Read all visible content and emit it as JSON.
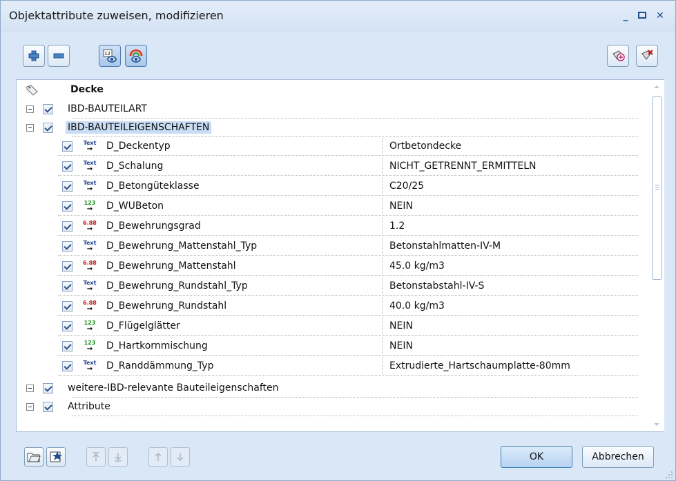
{
  "window": {
    "title": "Objektattribute zuweisen, modifizieren"
  },
  "colors": {
    "accent": "#2d4f86",
    "selection": "#c9ddf5",
    "text_icon": "#1f3f8f",
    "number_icon": "#1a8a1a",
    "decimal_icon": "#c01818"
  },
  "toolbar": {
    "left": [
      "plus-icon",
      "minus-icon",
      "number-eye-icon",
      "color-eye-icon"
    ],
    "right": [
      "favorite-add-icon",
      "favorite-remove-icon"
    ]
  },
  "tree": {
    "header": "Decke",
    "groups": [
      {
        "label": "IBD-BAUTEILART"
      },
      {
        "label": "IBD-BAUTEILEIGENSCHAFTEN"
      },
      {
        "label": "weitere-IBD-relevante Bauteileigenschaften"
      },
      {
        "label": "Attribute"
      }
    ],
    "attributes": [
      {
        "type": "text",
        "icon_label": "Text",
        "name": "D_Deckentyp",
        "value": "Ortbetondecke"
      },
      {
        "type": "text",
        "icon_label": "Text",
        "name": "D_Schalung",
        "value": "NICHT_GETRENNT_ERMITTELN"
      },
      {
        "type": "text",
        "icon_label": "Text",
        "name": "D_Betongüteklasse",
        "value": "C20/25"
      },
      {
        "type": "integer",
        "icon_label": "123",
        "name": "D_WUBeton",
        "value": "NEIN"
      },
      {
        "type": "decimal",
        "icon_label": "6.88",
        "name": "D_Bewehrungsgrad",
        "value": "1.2"
      },
      {
        "type": "text",
        "icon_label": "Text",
        "name": "D_Bewehrung_Mattenstahl_Typ",
        "value": "Betonstahlmatten-IV-M"
      },
      {
        "type": "decimal",
        "icon_label": "6.88",
        "name": "D_Bewehrung_Mattenstahl",
        "value": "45.0 kg/m3"
      },
      {
        "type": "text",
        "icon_label": "Text",
        "name": "D_Bewehrung_Rundstahl_Typ",
        "value": "Betonstabstahl-IV-S"
      },
      {
        "type": "decimal",
        "icon_label": "6.88",
        "name": "D_Bewehrung_Rundstahl",
        "value": "40.0 kg/m3"
      },
      {
        "type": "integer",
        "icon_label": "123",
        "name": "D_Flügelglätter",
        "value": "NEIN"
      },
      {
        "type": "integer",
        "icon_label": "123",
        "name": "D_Hartkornmischung",
        "value": "NEIN"
      },
      {
        "type": "text",
        "icon_label": "Text",
        "name": "D_Randdämmung_Typ",
        "value": "Extrudierte_Hartschaumplatte-80mm"
      }
    ]
  },
  "buttons": {
    "ok": "OK",
    "cancel": "Abbrechen"
  }
}
